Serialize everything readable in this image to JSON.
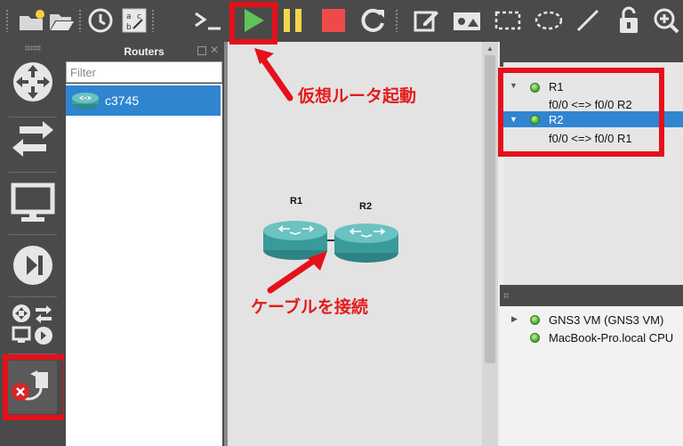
{
  "panels": {
    "routers_title": "Routers",
    "filter_placeholder": "Filter",
    "device_label": "c3745"
  },
  "canvas": {
    "node1": "R1",
    "node2": "R2"
  },
  "topology": {
    "node1": {
      "name": "R1",
      "link": "f0/0 <=> f0/0 R2"
    },
    "node2": {
      "name": "R2",
      "link": "f0/0 <=> f0/0 R1"
    }
  },
  "servers": {
    "s1": "GNS3 VM (GNS3 VM)",
    "s2": "MacBook-Pro.local CPU"
  },
  "annotations": {
    "start": "仮想ルータ起動",
    "cable": "ケーブルを接続"
  },
  "colors": {
    "accent_red": "#e5101a",
    "selection_blue": "#2f85d0",
    "play_green": "#5ec45a",
    "pause_yellow": "#f0d84a",
    "stop_red": "#ee4a4a"
  }
}
